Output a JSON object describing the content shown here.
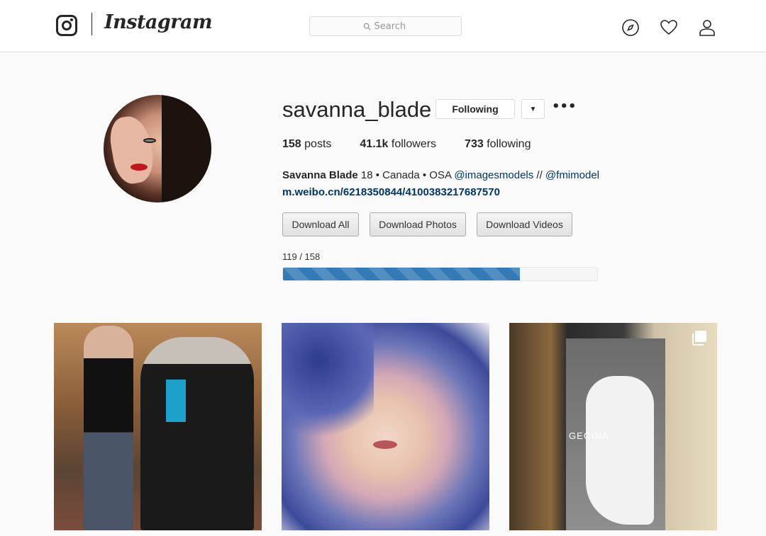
{
  "header": {
    "wordmark": "Instagram",
    "search_placeholder": "Search"
  },
  "profile": {
    "username": "savanna_blade",
    "following_label": "Following",
    "dropdown_glyph": "▼",
    "more_glyph": "•••",
    "stats": [
      {
        "count": "158",
        "label": "posts"
      },
      {
        "count": "41.1k",
        "label": "followers"
      },
      {
        "count": "733",
        "label": "following"
      }
    ],
    "bio": {
      "name": "Savanna Blade",
      "text": " 18 • Canada • OSA ",
      "mention1": "@imagesmodels",
      "separator": " // ",
      "mention2": "@fmimodel",
      "link": "m.weibo.cn/6218350844/4100383217687570"
    }
  },
  "downloader": {
    "buttons": [
      "Download All",
      "Download Photos",
      "Download Videos"
    ],
    "progress_text": "119 / 158",
    "progress_fraction": 0.7532
  },
  "posts": {
    "third_brand_text": "GEGINA"
  },
  "icons": [
    "instagram-logo-icon",
    "search-icon",
    "explore-compass-icon",
    "activity-heart-icon",
    "profile-person-icon",
    "multiple-photos-icon"
  ],
  "colors": {
    "link": "#003569",
    "progress": "#337ab7",
    "border": "#dbdbdb"
  }
}
